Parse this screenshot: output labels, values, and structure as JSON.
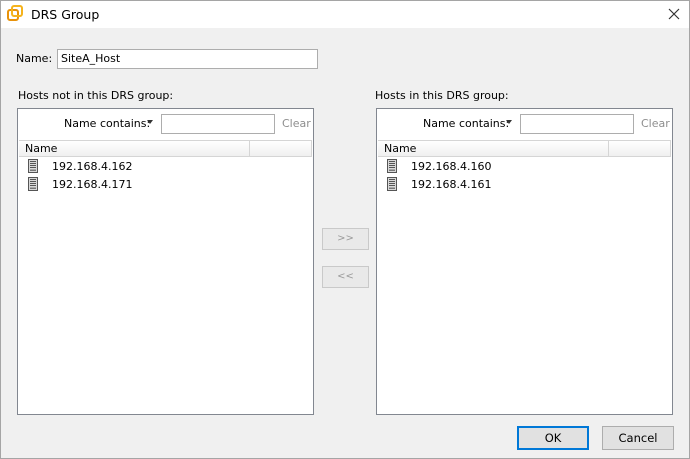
{
  "window": {
    "title": "DRS Group"
  },
  "name_field": {
    "label": "Name:",
    "value": "SiteA_Host"
  },
  "left_panel": {
    "label": "Hosts not in this DRS group:",
    "filter_label": "Name contains:",
    "clear_label": "Clear",
    "column_header": "Name",
    "hosts": [
      "192.168.4.162",
      "192.168.4.171"
    ]
  },
  "right_panel": {
    "label": "Hosts in this DRS group:",
    "filter_label": "Name contains:",
    "clear_label": "Clear",
    "column_header": "Name",
    "hosts": [
      "192.168.4.160",
      "192.168.4.161"
    ]
  },
  "transfer": {
    "add_label": ">>",
    "remove_label": "<<"
  },
  "footer": {
    "ok_label": "OK",
    "cancel_label": "Cancel"
  },
  "icons": {
    "app": "vsphere-logo-icon",
    "close": "close-icon",
    "host": "server-host-icon",
    "dropdown": "caret-down-icon"
  },
  "colors": {
    "app_icon": "#f0a30a",
    "default_button_border": "#0078d7"
  }
}
